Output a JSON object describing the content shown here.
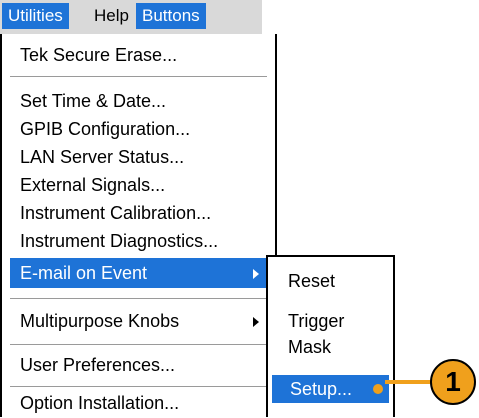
{
  "menubar": {
    "items": [
      "Utilities",
      "Help",
      "Buttons"
    ]
  },
  "utilities_menu": {
    "items": [
      "Tek Secure Erase...",
      "Set Time & Date...",
      "GPIB Configuration...",
      "LAN Server Status...",
      "External Signals...",
      "Instrument Calibration...",
      "Instrument Diagnostics...",
      "E-mail on Event",
      "Multipurpose Knobs",
      "User Preferences...",
      "Option Installation..."
    ]
  },
  "submenu": {
    "items": [
      "Reset",
      "Trigger",
      "Mask",
      "Setup..."
    ]
  },
  "callout": {
    "label": "1"
  },
  "colors": {
    "highlight": "#1e73d7",
    "callout": "#f0a01c"
  }
}
